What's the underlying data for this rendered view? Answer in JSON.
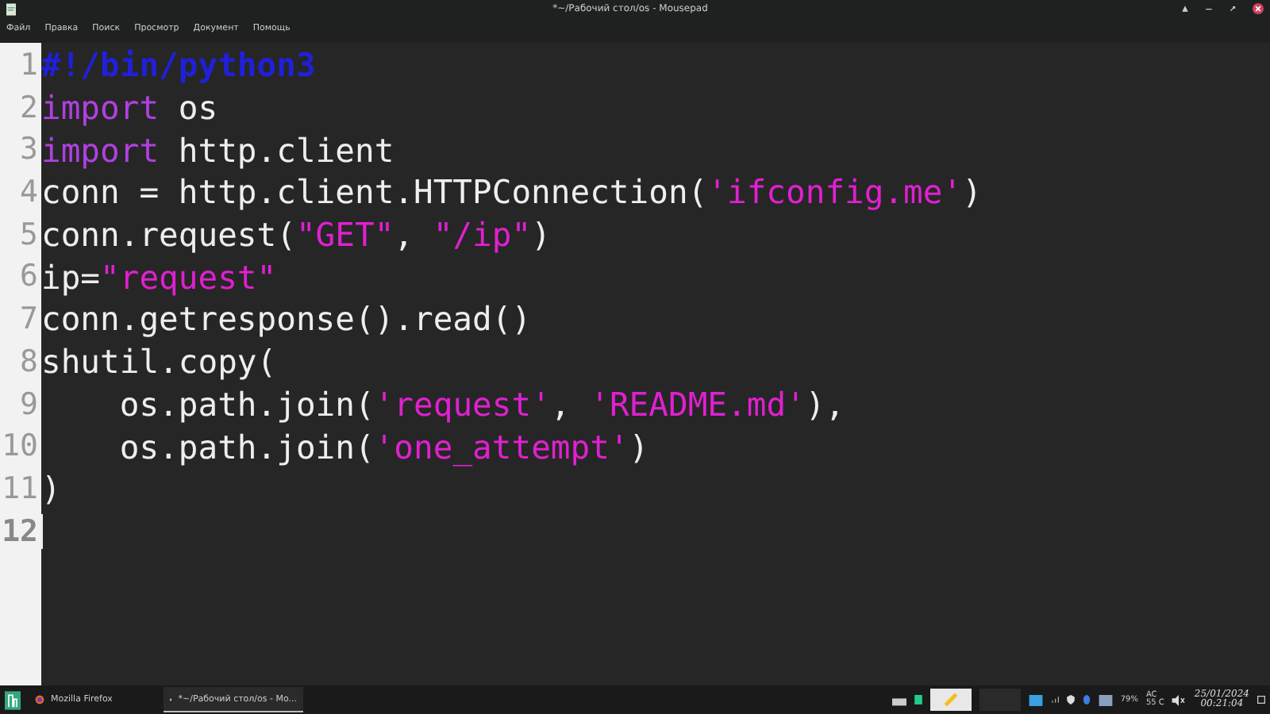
{
  "window": {
    "title": "*~/Рабочий стол/os - Mousepad"
  },
  "menu": [
    "Файл",
    "Правка",
    "Поиск",
    "Просмотр",
    "Документ",
    "Помощь"
  ],
  "editor": {
    "lines": [
      {
        "number": "1",
        "current": false,
        "tokens": [
          {
            "text": "#!/bin/python3",
            "kind": "comment"
          }
        ]
      },
      {
        "number": "2",
        "current": false,
        "tokens": [
          {
            "text": "import",
            "kind": "keyword"
          },
          {
            "text": " os",
            "kind": "plain"
          }
        ]
      },
      {
        "number": "3",
        "current": false,
        "tokens": [
          {
            "text": "import",
            "kind": "keyword"
          },
          {
            "text": " http.client",
            "kind": "plain"
          }
        ]
      },
      {
        "number": "4",
        "current": false,
        "tokens": [
          {
            "text": "conn = http.client.HTTPConnection(",
            "kind": "plain"
          },
          {
            "text": "'ifconfig.me'",
            "kind": "string"
          },
          {
            "text": ")",
            "kind": "plain"
          }
        ]
      },
      {
        "number": "5",
        "current": false,
        "tokens": [
          {
            "text": "conn.request(",
            "kind": "plain"
          },
          {
            "text": "\"GET\"",
            "kind": "string"
          },
          {
            "text": ", ",
            "kind": "plain"
          },
          {
            "text": "\"/ip\"",
            "kind": "string"
          },
          {
            "text": ")",
            "kind": "plain"
          }
        ]
      },
      {
        "number": "6",
        "current": false,
        "tokens": [
          {
            "text": "ip=",
            "kind": "plain"
          },
          {
            "text": "\"request\"",
            "kind": "string"
          }
        ]
      },
      {
        "number": "7",
        "current": false,
        "tokens": [
          {
            "text": "conn.getresponse().read()",
            "kind": "plain"
          }
        ]
      },
      {
        "number": "8",
        "current": false,
        "tokens": [
          {
            "text": "shutil.copy(",
            "kind": "plain"
          }
        ]
      },
      {
        "number": "9",
        "current": false,
        "tokens": [
          {
            "text": "    os.path.join(",
            "kind": "plain"
          },
          {
            "text": "'request'",
            "kind": "string"
          },
          {
            "text": ", ",
            "kind": "plain"
          },
          {
            "text": "'README.md'",
            "kind": "string"
          },
          {
            "text": "),",
            "kind": "plain"
          }
        ]
      },
      {
        "number": "10",
        "current": false,
        "tokens": [
          {
            "text": "    os.path.join(",
            "kind": "plain"
          },
          {
            "text": "'one_attempt'",
            "kind": "string"
          },
          {
            "text": ")",
            "kind": "plain"
          }
        ]
      },
      {
        "number": "11",
        "current": false,
        "tokens": [
          {
            "text": ")",
            "kind": "plain"
          }
        ]
      },
      {
        "number": "12",
        "current": true
      }
    ]
  },
  "taskbar": {
    "tasks": [
      {
        "label": "Mozilla Firefox",
        "selected": false
      },
      {
        "label": "*~/Рабочий стол/os - Mo...",
        "selected": true
      }
    ],
    "battery": "79%",
    "power": "AC",
    "temperature": "55 C",
    "date": "25/01/2024",
    "time": "00:21:04"
  }
}
